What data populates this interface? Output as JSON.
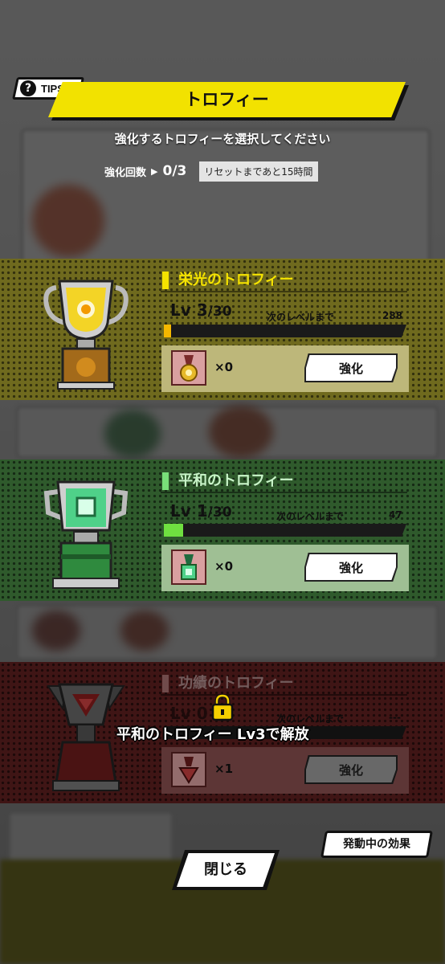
{
  "header": {
    "tips_label": "TIPS",
    "title": "トロフィー",
    "subtitle": "強化するトロフィーを選択してください",
    "count_label": "強化回数",
    "count_value": "0/3",
    "reset_text": "リセットまであと15時間"
  },
  "trophies": [
    {
      "name": "栄光のトロフィー",
      "lv_prefix": "Lv ",
      "lv_current": "3",
      "lv_max": "/30",
      "next_label": "次のレベルまで",
      "next_value": "288",
      "progress": 0.03,
      "quantity": "×0",
      "button": "強化",
      "color": "#6f6a1e",
      "accent": "#f5e300"
    },
    {
      "name": "平和のトロフィー",
      "lv_prefix": "Lv ",
      "lv_current": "1",
      "lv_max": "/30",
      "next_label": "次のレベルまで",
      "next_value": "47",
      "progress": 0.08,
      "quantity": "×0",
      "button": "強化",
      "color": "#2f5a2c",
      "accent": "#79e079"
    },
    {
      "name": "功績のトロフィー",
      "lv_prefix": "Lv ",
      "lv_current": "0",
      "lv_max": "",
      "next_label": "次のレベルまで",
      "next_value": "---",
      "progress": 0,
      "quantity": "×1",
      "button": "強化",
      "locked": true,
      "lock_message": "平和のトロフィー Lv3で解放",
      "color": "#5e1f1f",
      "accent": "#d9a5a5"
    }
  ],
  "footer": {
    "effects_button": "発動中の効果",
    "close_button": "閉じる"
  }
}
